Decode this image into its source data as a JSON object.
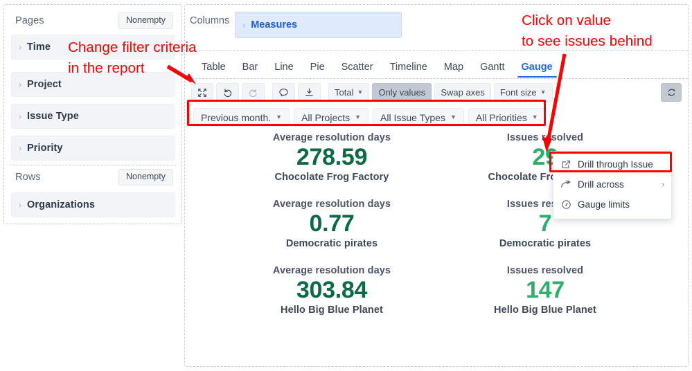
{
  "left_panel": {
    "pages": {
      "title": "Pages",
      "nonempty_label": "Nonempty",
      "fields": [
        {
          "label": "Time"
        },
        {
          "label": "Project"
        },
        {
          "label": "Issue Type"
        },
        {
          "label": "Priority"
        }
      ]
    },
    "rows": {
      "title": "Rows",
      "nonempty_label": "Nonempty",
      "fields": [
        {
          "label": "Organizations"
        }
      ]
    }
  },
  "main": {
    "columns_label": "Columns",
    "measures_chip": "Measures",
    "tabs": [
      {
        "label": "Table",
        "active": false
      },
      {
        "label": "Bar",
        "active": false
      },
      {
        "label": "Line",
        "active": false
      },
      {
        "label": "Pie",
        "active": false
      },
      {
        "label": "Scatter",
        "active": false
      },
      {
        "label": "Timeline",
        "active": false
      },
      {
        "label": "Map",
        "active": false
      },
      {
        "label": "Gantt",
        "active": false
      },
      {
        "label": "Gauge",
        "active": true
      }
    ],
    "toolbar": {
      "fullscreen_icon": "expand-icon",
      "undo_icon": "undo-icon",
      "redo_icon": "redo-icon",
      "comment_icon": "comment-icon",
      "download_icon": "download-icon",
      "total_label": "Total",
      "only_values_label": "Only values",
      "swap_axes_label": "Swap axes",
      "font_size_label": "Font size",
      "refresh_icon": "refresh-icon"
    },
    "filters": [
      {
        "label": "Previous month."
      },
      {
        "label": "All Projects"
      },
      {
        "label": "All Issue Types"
      },
      {
        "label": "All Priorities"
      }
    ]
  },
  "gauges": {
    "left_column": [
      {
        "title": "Average resolution days",
        "value": "278.59",
        "subtitle": "Chocolate Frog Factory",
        "color": "#0b6b44"
      },
      {
        "title": "Average resolution days",
        "value": "0.77",
        "subtitle": "Democratic pirates",
        "color": "#0b6b44"
      },
      {
        "title": "Average resolution days",
        "value": "303.84",
        "subtitle": "Hello Big Blue Planet",
        "color": "#0b6b44"
      }
    ],
    "right_column": [
      {
        "title": "Issues resolved",
        "value": "29",
        "subtitle": "Chocolate Frog Factory",
        "color": "#2eae6b"
      },
      {
        "title": "Issues resolved",
        "value": "7",
        "subtitle": "Democratic pirates",
        "color": "#2eae6b"
      },
      {
        "title": "Issues resolved",
        "value": "147",
        "subtitle": "Hello Big Blue Planet",
        "color": "#2eae6b"
      }
    ]
  },
  "context_menu": {
    "items": [
      {
        "label": "Drill through Issue",
        "icon": "external-link-icon",
        "highlighted": true,
        "has_submenu": false
      },
      {
        "label": "Drill across",
        "icon": "drill-across-icon",
        "highlighted": false,
        "has_submenu": true
      },
      {
        "label": "Gauge limits",
        "icon": "gauge-icon",
        "highlighted": false,
        "has_submenu": false
      }
    ],
    "submenu_caret": "›"
  },
  "annotations": {
    "color": "#ff0000",
    "left_line1": "Change filter criteria",
    "left_line2": "in the report",
    "right_line1": "Click on value",
    "right_line2": "to see issues behind"
  }
}
